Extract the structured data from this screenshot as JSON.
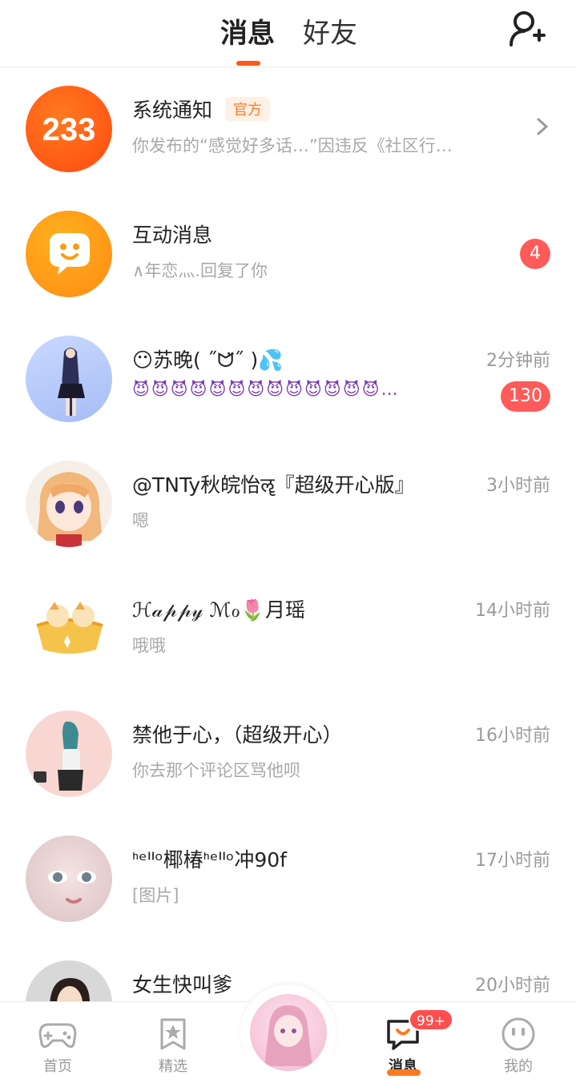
{
  "header": {
    "tab_messages": "消息",
    "tab_friends": "好友",
    "add_friend_icon": "add-user-icon"
  },
  "conversations": [
    {
      "name": "系统通知",
      "tag": "官方",
      "preview": "你发布的“感觉好多话…”因违反《社区行…",
      "time": "",
      "badge": "",
      "avatar": "233-logo"
    },
    {
      "name": "互动消息",
      "preview": "∧年恋灬.回复了你",
      "time": "",
      "badge": "4",
      "avatar": "chat-bubble-icon"
    },
    {
      "name": "😶苏晚( ˝ᗢ̈˝ )💦",
      "preview": "😈😈😈😈😈😈😈😈😈😈😈😈😈…",
      "time": "2分钟前",
      "badge": "130",
      "avatar": "anime-girl-blue"
    },
    {
      "name": "@TNTy秋皖怡ॡ『超级开心版』",
      "preview": "嗯",
      "time": "3小时前",
      "badge": "",
      "avatar": "anime-girl-orange"
    },
    {
      "name": "ℋ𝒶𝓅𝓅𝓎 ℳℴ🌷月瑶",
      "preview": "哦哦",
      "time": "14小时前",
      "badge": "",
      "avatar": "cat-sticker"
    },
    {
      "name": "禁他于心，（超级开心）",
      "preview": "你去那个评论区骂他呗",
      "time": "16小时前",
      "badge": "",
      "avatar": "anime-girl-pink"
    },
    {
      "name": "ᑋᵉᑊᑊᵒ椰椿ᑋᵉᑊᑊᵒ冲90f",
      "preview": "[图片]",
      "time": "17小时前",
      "badge": "",
      "avatar": "portrait-girl"
    },
    {
      "name": "女生快叫爹",
      "preview": "",
      "time": "20小时前",
      "badge": "",
      "avatar": "dark-hair-girl"
    }
  ],
  "nav": {
    "home": "首页",
    "featured": "精选",
    "messages": "消息",
    "messages_badge": "99+",
    "me": "我的"
  },
  "colors": {
    "accent": "#ff5a14",
    "badge": "#ff5b5b",
    "official_text": "#ff7a2b"
  }
}
